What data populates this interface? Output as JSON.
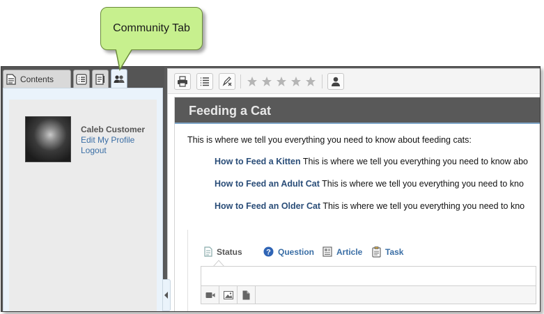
{
  "callout": {
    "text": "Community Tab"
  },
  "left_panel": {
    "tabs": {
      "contents_label": "Contents",
      "index_icon": "list-icon",
      "notes_icon": "notes-icon",
      "community_icon": "community-icon"
    },
    "profile": {
      "name": "Caleb Customer",
      "edit_link": "Edit My Profile",
      "logout_link": "Logout"
    }
  },
  "toolbar": {
    "icons": [
      "print-icon",
      "list-icon",
      "edit-clear-icon",
      "user-icon"
    ],
    "rating": {
      "stars_filled": 0,
      "stars_total": 5
    }
  },
  "content": {
    "title": "Feeding a Cat",
    "intro": "This is where we tell you everything you need to know about feeding cats:",
    "links": [
      {
        "title": "How to Feed a Kitten",
        "text": "This is where we tell you everything you need to know abo"
      },
      {
        "title": "How to Feed an Adult Cat",
        "text": "This is where we tell you everything you need to kno"
      },
      {
        "title": "How to Feed an Older Cat",
        "text": "This is where we tell you everything you need to kno"
      }
    ]
  },
  "composer": {
    "tabs": [
      {
        "label": "Status",
        "icon": "status-icon"
      },
      {
        "label": "Question",
        "icon": "question-icon"
      },
      {
        "label": "Article",
        "icon": "article-icon"
      },
      {
        "label": "Task",
        "icon": "task-icon"
      }
    ],
    "attachments": [
      "video-icon",
      "image-icon",
      "file-icon"
    ]
  },
  "colors": {
    "callout_bg": "#c7f08e",
    "title_bar": "#595959",
    "link": "#2a4d78",
    "accent_link": "#3a6ea5"
  }
}
